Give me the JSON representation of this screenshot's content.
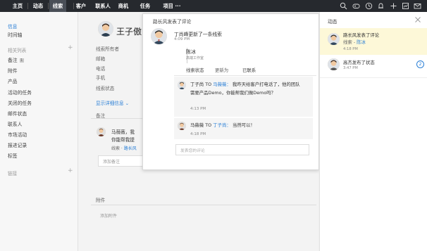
{
  "nav": {
    "items": [
      "主页",
      "动态",
      "线索",
      "客户",
      "联系人",
      "商机",
      "任务",
      "项目 ···"
    ],
    "active_index": 2
  },
  "sidebar": {
    "items": [
      {
        "label": "信息",
        "active": true
      },
      {
        "label": "时间轴"
      }
    ],
    "related_title": "相关列表",
    "related_items": [
      {
        "label": "备注",
        "badge": "1"
      },
      {
        "label": "附件"
      },
      {
        "label": "产品"
      },
      {
        "label": "活动的任务"
      },
      {
        "label": "关闭的任务"
      },
      {
        "label": "邮件状态"
      },
      {
        "label": "联系人"
      },
      {
        "label": "市场活动"
      },
      {
        "label": "报进记录"
      },
      {
        "label": "标签"
      }
    ],
    "links_title": "链接"
  },
  "main": {
    "name": "王子傲",
    "fields": [
      "线索所有者",
      "邮箱",
      "电话",
      "手机",
      "线索状态"
    ],
    "show_details": "显示详细信息",
    "notes_title": "备注",
    "note_author": "马薇薇，我",
    "note_text": "你能帮我提",
    "note_meta_prefix": "线索 · ",
    "note_meta_link": "路长风",
    "add_note_placeholder": "添加备注",
    "attachments_title": "附件",
    "add_attachment": "添加附件"
  },
  "popup": {
    "header": "路长风发表了评论",
    "post_text": "丁尚峰更新了一条线索",
    "post_time": "4:09 PM",
    "card_name": "陈冰",
    "card_company": "高端工作室",
    "card_labels": [
      "线索状态",
      "更新为",
      "已联系"
    ],
    "replies": [
      {
        "author": "丁子尚",
        "to_word": "TO",
        "to": "马薇薇：",
        "text_line1": "我昨天给客户打电话了，他的团队",
        "text_line2": "需要产品Demo，你能帮我们做Demo吗？",
        "time": "4:13 PM"
      },
      {
        "author": "马薇薇",
        "to_word": "TO",
        "to": "丁子尚：",
        "text_line1": "当然可以！",
        "time": "4:18 PM"
      }
    ],
    "comment_placeholder": "发表您的评论"
  },
  "rpanel": {
    "title": "动态",
    "notifications": [
      {
        "title": "路长风发表了评论",
        "line2_prefix": "线索 - ",
        "line2_link": "陈冰",
        "time": "4:18 PM",
        "highlighted": true
      },
      {
        "title": "高杰发布了状态",
        "time": "3:47 PM",
        "count": "2"
      }
    ]
  },
  "colors": {
    "accent": "#2a7fd6",
    "topbar": "#26292e",
    "highlight": "#fdf8d8"
  }
}
